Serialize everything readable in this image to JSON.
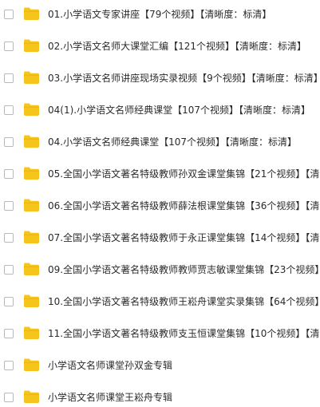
{
  "folder_color": "#f5c51c",
  "icons": {
    "folder": "folder-icon",
    "checkbox": "checkbox"
  },
  "files": [
    {
      "name": "01.小学语文专家讲座【79个视频】【清晰度：标清】"
    },
    {
      "name": "02.小学语文名师大课堂汇编【121个视频】【清晰度：标清】"
    },
    {
      "name": "03.小学语文名师讲座现场实录视频【9个视频】【清晰度：标清】"
    },
    {
      "name": "04(1).小学语文名师经典课堂【107个视频】【清晰度：标清】"
    },
    {
      "name": "04.小学语文名师经典课堂【107个视频】【清晰度：标清】"
    },
    {
      "name": "05.全国小学语文著名特级教师孙双金课堂集锦【21个视频】【清"
    },
    {
      "name": "06.全国小学语文著名特级教师薛法根课堂集锦【36个视频】【清"
    },
    {
      "name": "07.全国小学语文著名特级教师于永正课堂集锦【14个视频】【清"
    },
    {
      "name": "09.全国小学语文著名特级教师教师贾志敏课堂集锦【23个视频】"
    },
    {
      "name": "10.全国小学语文著名特级教师王崧舟课堂实录集锦【64个视频】"
    },
    {
      "name": "11.全国小学语文著名特级教师支玉恒课堂集锦【10个视频】【清"
    },
    {
      "name": "小学语文名师课堂孙双金专辑"
    },
    {
      "name": "小学语文名师课堂王崧舟专辑"
    }
  ]
}
